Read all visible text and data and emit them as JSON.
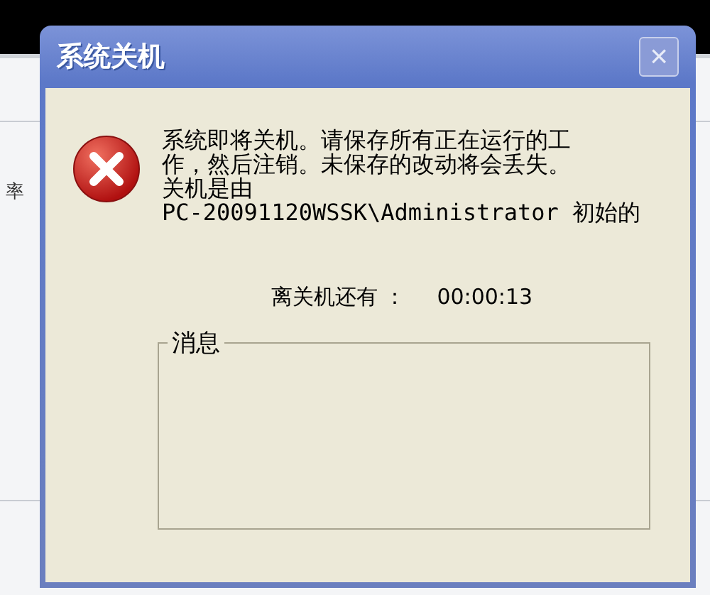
{
  "background_window": {
    "text": "率"
  },
  "dialog": {
    "title": "系统关机",
    "close": "×",
    "message": [
      "系统即将关机。请保存所有正在运行的工",
      "作，然后注销。未保存的改动将会丢失。",
      "关机是由",
      "PC-20091120WSSK\\Administrator 初始的"
    ],
    "countdown_label": "离关机还有 ：",
    "countdown_value": "00:00:13",
    "group": {
      "label": "消息"
    }
  }
}
